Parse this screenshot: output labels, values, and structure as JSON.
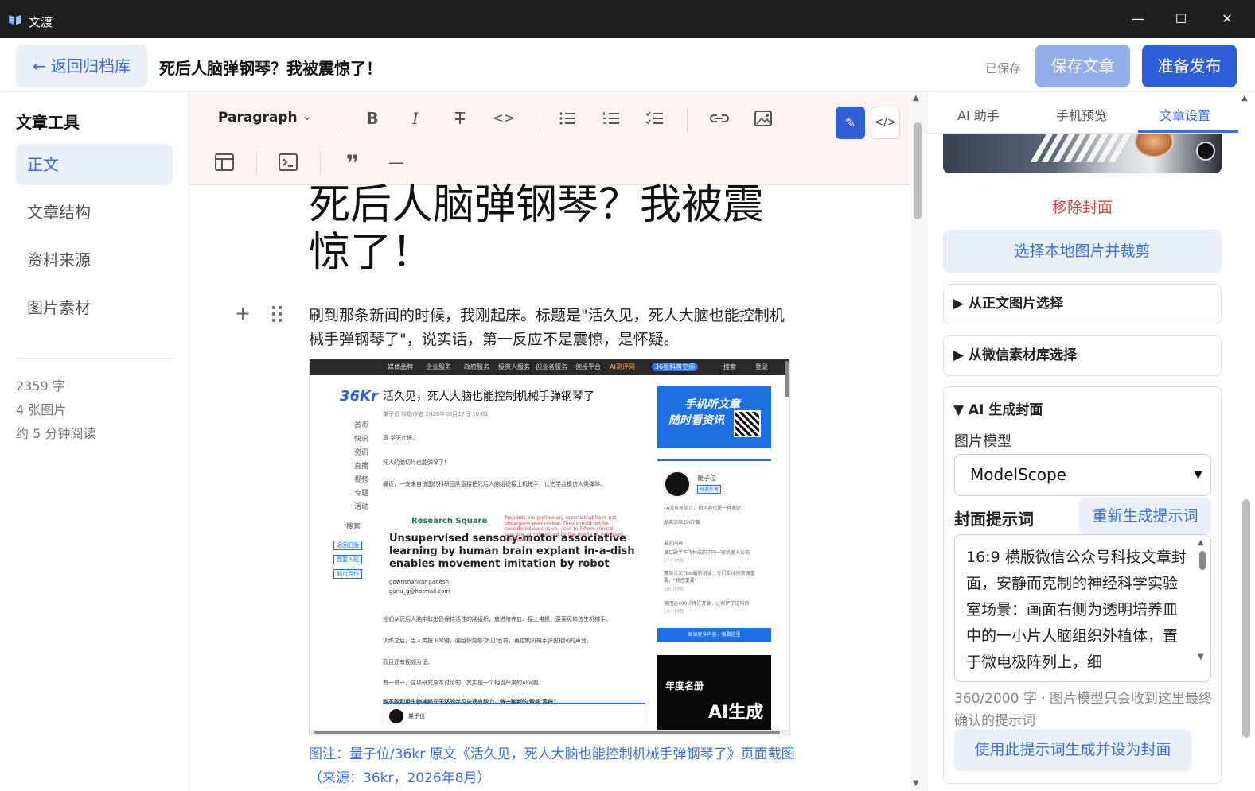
{
  "window": {
    "app_name": "文渡",
    "minimize_glyph": "—",
    "maximize_glyph": "☐",
    "close_glyph": "✕"
  },
  "header": {
    "back_label": "← 返回归档库",
    "doc_title": "死后人脑弹钢琴？我被震惊了！",
    "saved_status": "已保存",
    "save_label": "保存文章",
    "publish_label": "准备发布"
  },
  "sidebar": {
    "title": "文章工具",
    "items": [
      {
        "label": "正文",
        "active": true
      },
      {
        "label": "文章结构",
        "active": false
      },
      {
        "label": "资料来源",
        "active": false
      },
      {
        "label": "图片素材",
        "active": false
      }
    ],
    "stats": [
      "2359 字",
      "4 张图片",
      "约 5 分钟阅读"
    ]
  },
  "toolbar": {
    "paragraph_label": "Paragraph",
    "icons": [
      "bold-icon",
      "italic-icon",
      "strikethrough-icon",
      "code-icon",
      "bullet-list-icon",
      "ordered-list-icon",
      "task-list-icon",
      "link-icon",
      "image-icon",
      "table-icon",
      "code-block-icon",
      "quote-icon",
      "horizontal-rule-icon",
      "pen-icon",
      "source-code-icon"
    ]
  },
  "article": {
    "title": "死后人脑弹钢琴？我被震惊了！",
    "paragraph": "刷到那条新闻的时候，我刚起床。标题是\"活久见，死人大脑也能控制机械手弹钢琴了\"，说实话，第一反应不是震惊，是怀疑。",
    "caption": "图注：量子位/36kr 原文《活久见，死人大脑也能控制机械手弹钢琴了》页面截图（来源：36kr，2026年8月）"
  },
  "screenshot": {
    "nav_items": [
      "媒体品牌",
      "企业服务",
      "政府服务",
      "投资人服务",
      "创业者服务",
      "创投平台",
      "AI测评网",
      "36氪科普空间",
      "搜索",
      "登录"
    ],
    "logo": "36Kr",
    "menu": [
      "首页",
      "快讯",
      "资讯",
      "直播",
      "视频",
      "专题",
      "活动",
      "搜索",
      "返回旧版",
      "我要入驻",
      "城市合作"
    ],
    "headline": "活久见，死人大脑也能控制机械手弹钢琴了",
    "meta": "量子位  特邀作者  2026年08月17日 10:01",
    "lines": [
      "真 学无止境。",
      "死人的脑切片也能弹琴了！",
      "最近，一支来自法国的科研团队直接把死后人脑组织接上机械手，让它学会模仿人类弹琴。",
      "他们从死后人脑中取出仍保持活性的脑组织，放进培养皿、接上电极，蓬莱风和仿生机械手。",
      "训练之后，当人类按下琴键，脑组织能够'听见'音符，再控制机械手弹出相同的声音。",
      "而且还有视频为证。",
      "有一说一，这项研究原本讨论的，其实是一个相当严肃的AI问题：",
      "能不能利用生物神经元天然的学习与适应能力，做一种新的'智能'系统？"
    ],
    "rs_logo": "Research Square",
    "rs_notice": "Preprints are preliminary reports that have not undergone peer review. They should not be considered conclusive, used to inform clinical practice, or referenced by the media as validated information.",
    "paper_title": "Unsupervised sensory-motor associative learning by human brain explant in-a-dish enables movement imitation by robot",
    "paper_author_1": "gowrishankar ganesh",
    "paper_author_2": "ganu_g@hotmail.com",
    "ad1_line1": "手机听文章",
    "ad1_line2": "随时看资讯",
    "author_name": "量子位",
    "author_tag": "特邀作者",
    "card_lines": [
      "TA没有写简介，但内容也是一种表达",
      "发表文章3967篇",
      "最近内容",
      "黄仁勋手下飞林成的了同一家机器人公司",
      "17小时前",
      "赛博义父Tibo最新访谈：专门实体技师强重要，\"我感重要\"",
      "18小时前",
      "美团达400亿押注开源，让家铲子边陪你",
      "19小时前"
    ],
    "card_more": "阅读更多内容，狠戳这里",
    "ad2_line1": "年度名册",
    "ad2_line2": "AI生成"
  },
  "right_panel": {
    "tabs": [
      {
        "label": "AI 助手",
        "active": false
      },
      {
        "label": "手机预览",
        "active": false
      },
      {
        "label": "文章设置",
        "active": true
      }
    ],
    "remove_cover": "移除封面",
    "pick_local": "选择本地图片并裁剪",
    "from_body": "▶ 从正文图片选择",
    "from_wechat": "▶ 从微信素材库选择",
    "ai_cover_title": "▼ AI 生成封面",
    "model_label": "图片模型",
    "model_value": "ModelScope",
    "prompt_label": "封面提示词",
    "regen_label": "重新生成提示词",
    "prompt_text": "16:9 横版微信公众号科技文章封面，安静而克制的神经科学实验室场景：画面右侧为透明培养皿中的一小片人脑组织外植体，置于微电极阵列上，细",
    "count_hint": "360/2000 字 · 图片模型只会收到这里最终确认的提示词",
    "generate_label": "使用此提示词生成并设为封面"
  }
}
